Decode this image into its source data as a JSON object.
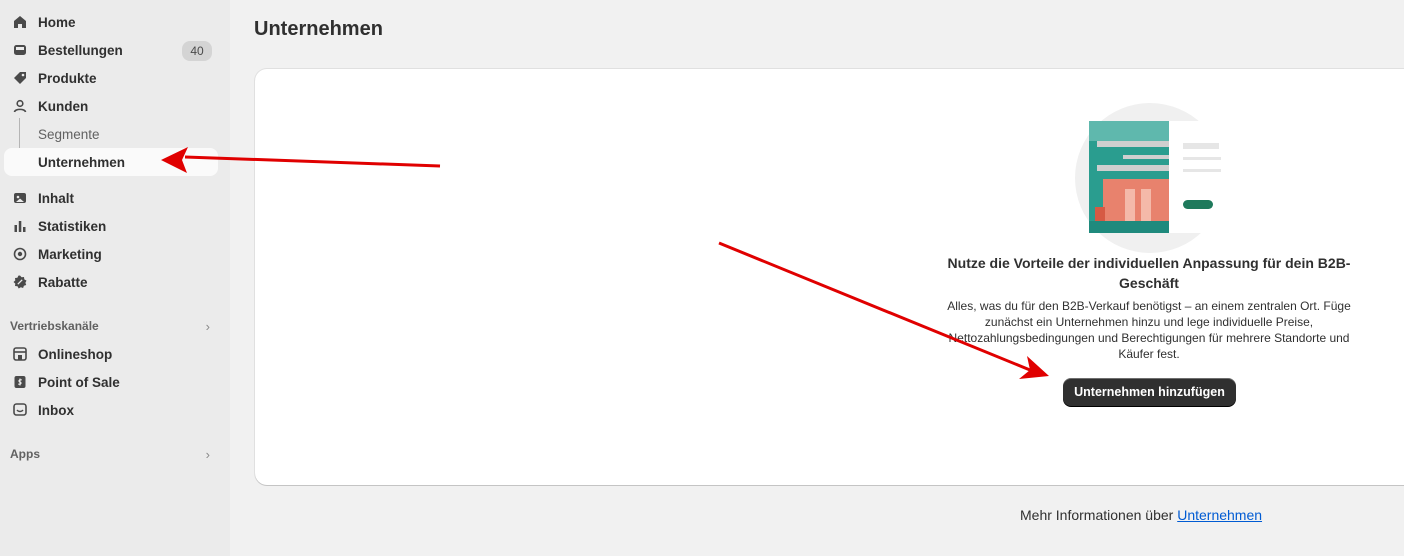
{
  "sidebar": {
    "items": [
      {
        "label": "Home",
        "icon": "home-icon"
      },
      {
        "label": "Bestellungen",
        "icon": "inbox-tray-icon",
        "badge": "40"
      },
      {
        "label": "Produkte",
        "icon": "tag-icon"
      },
      {
        "label": "Kunden",
        "icon": "person-icon"
      }
    ],
    "sub_items": [
      {
        "label": "Segmente"
      },
      {
        "label": "Unternehmen",
        "active": true
      }
    ],
    "items2": [
      {
        "label": "Inhalt",
        "icon": "image-icon"
      },
      {
        "label": "Statistiken",
        "icon": "bar-chart-icon"
      },
      {
        "label": "Marketing",
        "icon": "target-icon"
      },
      {
        "label": "Rabatte",
        "icon": "discount-icon"
      }
    ],
    "sales_channels_label": "Vertriebskanäle",
    "channels": [
      {
        "label": "Onlineshop",
        "icon": "store-icon"
      },
      {
        "label": "Point of Sale",
        "icon": "pos-icon"
      },
      {
        "label": "Inbox",
        "icon": "chat-inbox-icon"
      }
    ],
    "apps_label": "Apps"
  },
  "main": {
    "title": "Unternehmen",
    "empty_state": {
      "heading": "Nutze die Vorteile der individuellen Anpassung für dein B2B-Geschäft",
      "body": "Alles, was du für den B2B-Verkauf benötigst – an einem zentralen Ort. Füge zunächst ein Unternehmen hinzu und lege individuelle Preise, Nettozahlungsbedingungen und Berechtigungen für mehrere Standorte und Käufer fest.",
      "button": "Unternehmen hinzufügen"
    },
    "more_info_prefix": "Mehr Informationen über",
    "more_info_link": "Unternehmen"
  },
  "colors": {
    "sidebar_bg": "#ebebeb",
    "page_bg": "#f1f1f1",
    "primary_button": "#303030",
    "annotation_arrow": "#e00000",
    "link": "#005bd3"
  }
}
